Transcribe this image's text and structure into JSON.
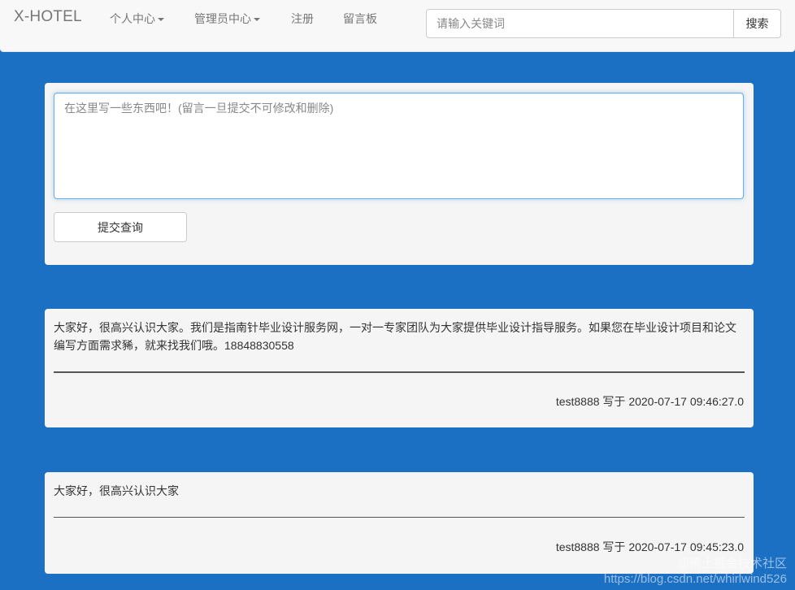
{
  "navbar": {
    "brand": "X-HOTEL",
    "items": [
      {
        "label": "个人中心",
        "dropdown": true
      },
      {
        "label": "管理员中心",
        "dropdown": true
      },
      {
        "label": "注册",
        "dropdown": false
      },
      {
        "label": "留言板",
        "dropdown": false
      }
    ],
    "search": {
      "placeholder": "请输入关键词",
      "value": "",
      "button_label": "搜索"
    }
  },
  "compose": {
    "placeholder": "在这里写一些东西吧！(留言一旦提交不可修改和删除)",
    "submit_label": "提交查询"
  },
  "messages": [
    {
      "text": "大家好，很高兴认识大家。我们是指南针毕业设计服务网，一对一专家团队为大家提供毕业设计指导服务。如果您在毕业设计项目和论文编写方面需求豨，就来找我们哦。18848830558",
      "meta": "test8888 写于 2020-07-17 09:46:27.0"
    },
    {
      "text": "大家好，很高兴认识大家",
      "meta": "test8888 写于 2020-07-17 09:45:23.0"
    }
  ],
  "watermark": {
    "line1": "@稀土掘金技术社区",
    "line2": "https://blog.csdn.net/whirlwind526"
  },
  "colors": {
    "page_background": "#1b70c3",
    "navbar_background": "#f8f8f8",
    "panel_background": "#f5f5f5",
    "focus_border": "#66afe9"
  }
}
